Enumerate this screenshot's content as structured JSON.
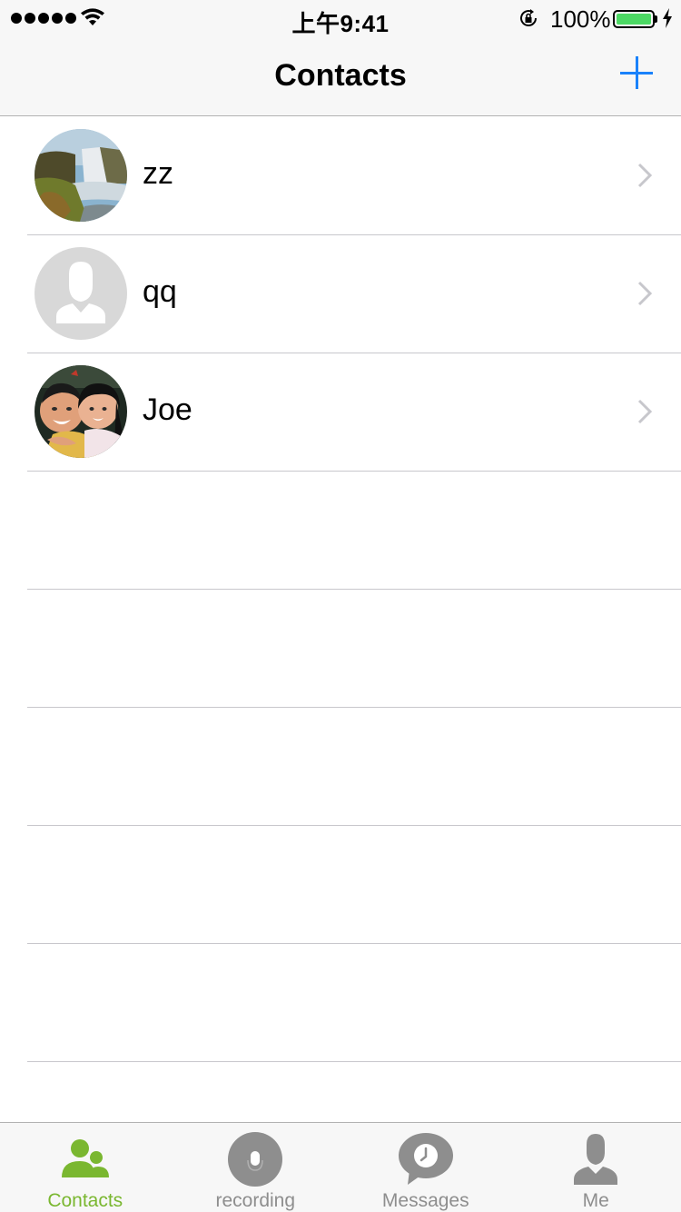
{
  "status_bar": {
    "time": "上午9:41",
    "battery_percent": "100%",
    "signal_bars": 5,
    "battery_level": 1.0,
    "battery_color": "#4cd964"
  },
  "nav": {
    "title": "Contacts",
    "add_icon": "plus-icon",
    "accent_color": "#1a82fb"
  },
  "contacts": [
    {
      "name": "zz",
      "avatar": "photo-waterfall"
    },
    {
      "name": "qq",
      "avatar": "default-person-placeholder"
    },
    {
      "name": "Joe",
      "avatar": "photo-children"
    }
  ],
  "tabs": [
    {
      "label": "Contacts",
      "icon": "contacts-icon",
      "active": true
    },
    {
      "label": "recording",
      "icon": "microphone-icon",
      "active": false
    },
    {
      "label": "Messages",
      "icon": "message-clock-icon",
      "active": false
    },
    {
      "label": "Me",
      "icon": "person-icon",
      "active": false
    }
  ],
  "colors": {
    "active_tab": "#7ab730",
    "inactive_tab": "#8e8e8e"
  }
}
